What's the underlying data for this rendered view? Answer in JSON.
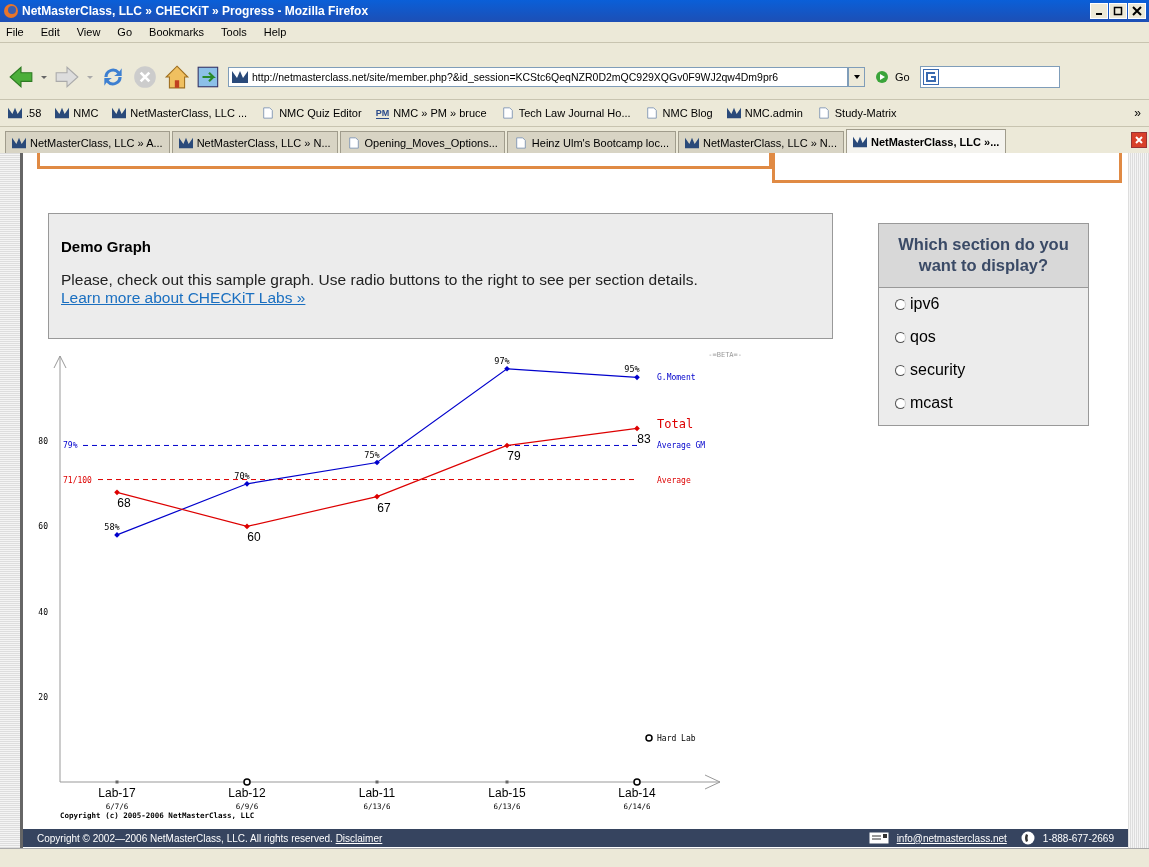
{
  "window": {
    "title": "NetMasterClass, LLC » CHECKiT » Progress - Mozilla Firefox"
  },
  "menu": [
    "File",
    "Edit",
    "View",
    "Go",
    "Bookmarks",
    "Tools",
    "Help"
  ],
  "address": {
    "value": "http://netmasterclass.net/site/member.php?&id_session=KCStc6QeqNZR0D2mQC929XQGv0F9WJ2qw4Dm9pr6",
    "go": "Go"
  },
  "bookmarks": [
    {
      "label": ".58",
      "kind": "nmc"
    },
    {
      "label": "NMC",
      "kind": "nmc"
    },
    {
      "label": "NetMasterClass, LLC ...",
      "kind": "nmc"
    },
    {
      "label": "NMC Quiz Editor",
      "kind": "page"
    },
    {
      "label": "NMC » PM » bruce",
      "kind": "pm",
      "badge": "PM"
    },
    {
      "label": "Tech Law Journal Ho...",
      "kind": "page"
    },
    {
      "label": "NMC Blog",
      "kind": "page"
    },
    {
      "label": "NMC.admin",
      "kind": "nmc"
    },
    {
      "label": "Study-Matrix",
      "kind": "page"
    }
  ],
  "bookmarks_more": "»",
  "tabs": [
    {
      "label": "NetMasterClass, LLC » A...",
      "kind": "nmc",
      "selected": false
    },
    {
      "label": "NetMasterClass, LLC » N...",
      "kind": "nmc",
      "selected": false
    },
    {
      "label": "Opening_Moves_Options...",
      "kind": "page",
      "selected": false
    },
    {
      "label": "Heinz Ulm's Bootcamp loc...",
      "kind": "page",
      "selected": false
    },
    {
      "label": "NetMasterClass, LLC » N...",
      "kind": "nmc",
      "selected": false
    },
    {
      "label": "NetMasterClass, LLC »...",
      "kind": "nmc",
      "selected": true
    }
  ],
  "intro": {
    "title": "Demo Graph",
    "text": "Please, check out this sample graph. Use radio buttons to the right to see per section details.",
    "link": "Learn more about CHECKiT Labs »"
  },
  "sections": {
    "question": "Which section do you want to display?",
    "options": [
      {
        "label": "ipv6",
        "selected": false
      },
      {
        "label": "qos",
        "selected": false
      },
      {
        "label": "security",
        "selected": false
      },
      {
        "label": "mcast",
        "selected": false
      }
    ]
  },
  "graph": {
    "beta": "-=BETA=-",
    "dates": [
      "6/7/6",
      "6/9/6",
      "6/13/6",
      "6/13/6",
      "6/14/6"
    ],
    "hard_lab": [
      false,
      true,
      false,
      false,
      true
    ],
    "hard_lab_legend": "Hard Lab",
    "copyright": "Copyright (c) 2005-2006   NetMasterClass, LLC",
    "ref_values": [
      "79%",
      "71/100"
    ],
    "chart_data": {
      "type": "line",
      "categories": [
        "Lab-17",
        "Lab-12",
        "Lab-11",
        "Lab-15",
        "Lab-14"
      ],
      "ylim": [
        0,
        100
      ],
      "yticks": [
        20,
        40,
        60,
        80
      ],
      "legend": "right",
      "series": [
        {
          "name": "G.Moment",
          "color": "#0000cc",
          "marker": "diamond",
          "values": [
            58,
            70,
            75,
            97,
            95
          ],
          "value_labels": [
            "58%",
            "70%",
            "75%",
            "97%",
            "95%"
          ]
        },
        {
          "name": "Total",
          "color": "#dd0000",
          "marker": "diamond",
          "values": [
            68,
            60,
            67,
            79,
            83
          ],
          "value_labels": [
            "68",
            "60",
            "67",
            "79",
            "83"
          ]
        }
      ],
      "ref_lines": [
        {
          "axis": "y",
          "value": 79,
          "label": "Average GM",
          "color": "#0000cc"
        },
        {
          "axis": "y",
          "value": 71,
          "label": "Average",
          "color": "#dd0000"
        }
      ]
    }
  },
  "footer": {
    "copyright": "Copyright © 2002—2006 NetMasterClass, LLC. All rights reserved.",
    "disclaimer": "Disclaimer",
    "email": "info@netmasterclass.net",
    "phone": "1-888-677-2669"
  }
}
